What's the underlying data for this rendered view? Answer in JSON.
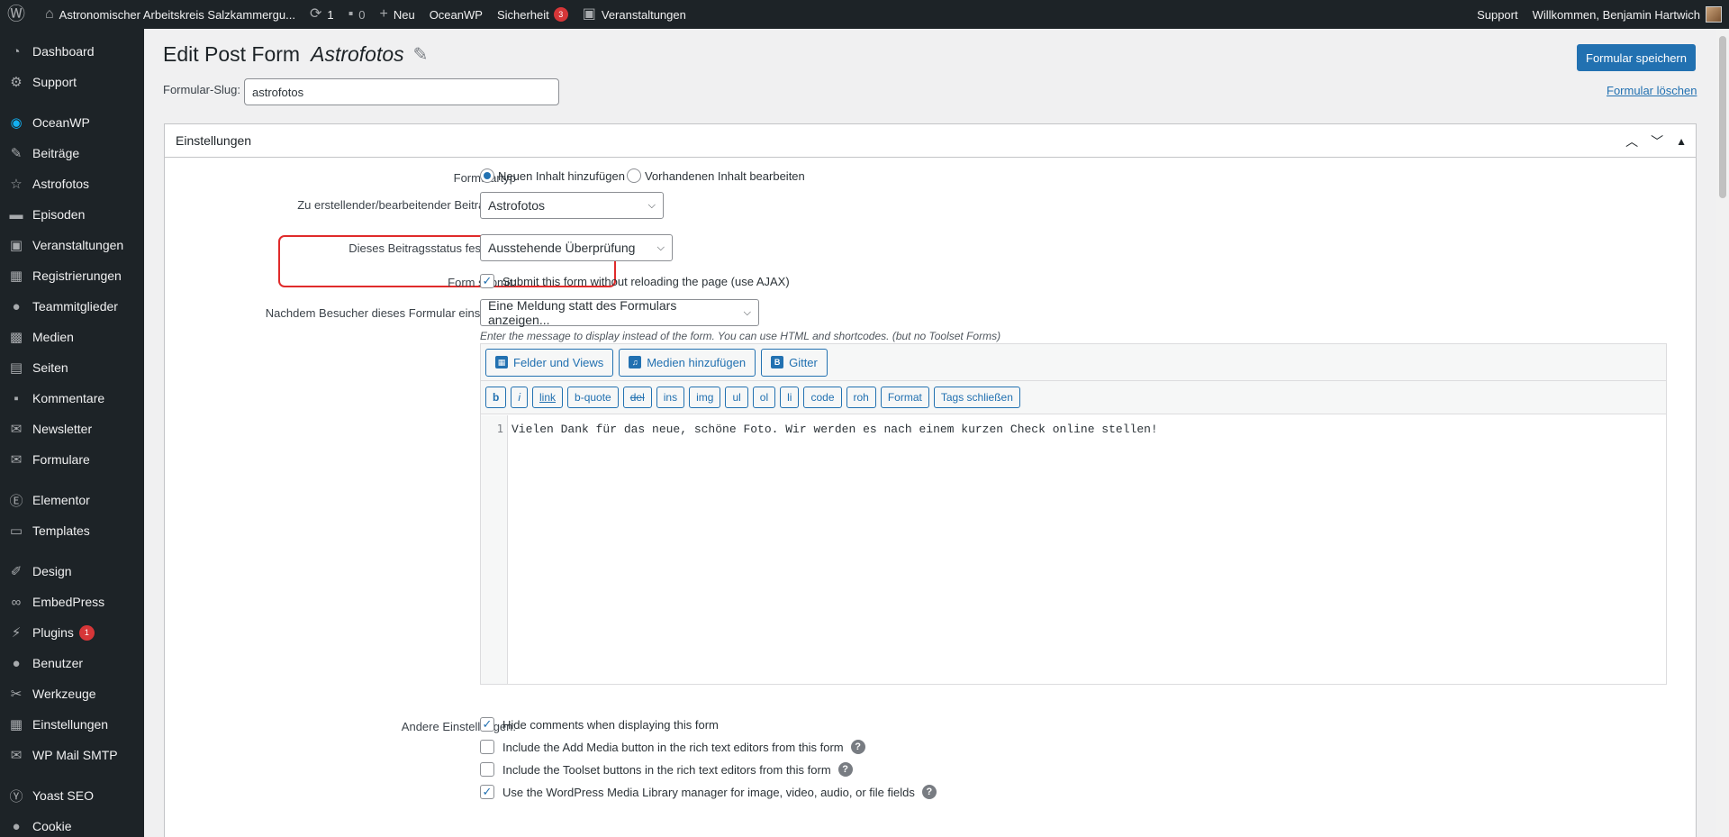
{
  "adminbar": {
    "site_name": "Astronomischer Arbeitskreis Salzkammergu...",
    "updates_count": "1",
    "comments_count": "0",
    "new_label": "Neu",
    "oceanwp_label": "OceanWP",
    "security_label": "Sicherheit",
    "security_count": "3",
    "events_label": "Veranstaltungen",
    "support_label": "Support",
    "welcome_label": "Willkommen, Benjamin Hartwich"
  },
  "sidebar": {
    "items": [
      {
        "label": "Dashboard",
        "icon": "dashboard-icon"
      },
      {
        "label": "Support",
        "icon": "gear-icon"
      },
      {
        "label": "OceanWP",
        "icon": "oceanwp-icon"
      },
      {
        "label": "Beiträge",
        "icon": "pin-icon"
      },
      {
        "label": "Astrofotos",
        "icon": "star-icon"
      },
      {
        "label": "Episoden",
        "icon": "podcast-icon"
      },
      {
        "label": "Veranstaltungen",
        "icon": "calendar-clapper-icon"
      },
      {
        "label": "Registrierungen",
        "icon": "calendar-icon"
      },
      {
        "label": "Teammitglieder",
        "icon": "users-icon"
      },
      {
        "label": "Medien",
        "icon": "media-icon"
      },
      {
        "label": "Seiten",
        "icon": "pages-icon"
      },
      {
        "label": "Kommentare",
        "icon": "comment-icon"
      },
      {
        "label": "Newsletter",
        "icon": "mail-icon"
      },
      {
        "label": "Formulare",
        "icon": "mail-form-icon"
      },
      {
        "label": "Elementor",
        "icon": "elementor-icon"
      },
      {
        "label": "Templates",
        "icon": "folder-icon"
      },
      {
        "label": "Design",
        "icon": "brush-icon"
      },
      {
        "label": "EmbedPress",
        "icon": "link-icon"
      },
      {
        "label": "Plugins",
        "icon": "plugin-icon",
        "count": "1"
      },
      {
        "label": "Benutzer",
        "icon": "user-icon"
      },
      {
        "label": "Werkzeuge",
        "icon": "wrench-icon"
      },
      {
        "label": "Einstellungen",
        "icon": "settings-icon"
      },
      {
        "label": "WP Mail SMTP",
        "icon": "mail-smtp-icon"
      },
      {
        "label": "Yoast SEO",
        "icon": "yoast-icon"
      },
      {
        "label": "Cookie",
        "icon": "cookie-icon"
      }
    ]
  },
  "header": {
    "title": "Edit Post Form",
    "post_name": "Astrofotos",
    "save_button": "Formular speichern",
    "slug_label": "Formular-Slug:",
    "slug_value": "astrofotos",
    "delete_link": "Formular löschen"
  },
  "settings": {
    "box_title": "Einstellungen",
    "form_type_label": "Formulartyp",
    "form_type_option_new": "Neuen Inhalt hinzufügen",
    "form_type_option_edit": "Vorhandenen Inhalt bearbeiten",
    "post_type_label": "Zu erstellender/bearbeitender Beitragstyp:",
    "post_type_value": "Astrofotos",
    "post_status_label": "Dieses Beitragsstatus festlegen:",
    "post_status_value": "Ausstehende Überprüfung",
    "form_submit_label": "Form submit:",
    "form_submit_text": "Submit this form without reloading the page (use AJAX)",
    "after_submit_label": "Nachdem Besucher dieses Formular einsenden:",
    "after_submit_value": "Eine Meldung statt des Formulars anzeigen...",
    "message_hint": "Enter the message to display instead of the form. You can use HTML and shortcodes. (but no Toolset Forms)",
    "other_label": "Andere Einstellungen:",
    "other_options": [
      {
        "text": "Hide comments when displaying this form",
        "checked": true,
        "help": false
      },
      {
        "text": "Include the Add Media button in the rich text editors from this form",
        "checked": false,
        "help": true
      },
      {
        "text": "Include the Toolset buttons in the rich text editors from this form",
        "checked": false,
        "help": true
      },
      {
        "text": "Use the WordPress Media Library manager for image, video, audio, or file fields",
        "checked": true,
        "help": true
      }
    ]
  },
  "editor": {
    "toolbar_buttons": [
      "Felder und Views",
      "Medien hinzufügen",
      "Gitter"
    ],
    "quicktags": [
      "b",
      "i",
      "link",
      "b-quote",
      "del",
      "ins",
      "img",
      "ul",
      "ol",
      "li",
      "code",
      "roh",
      "Format",
      "Tags schließen"
    ],
    "line_number": "1",
    "content": "Vielen Dank für das neue, schöne Foto. Wir werden es nach einem kurzen Check online stellen!"
  },
  "colors": {
    "accent": "#2271b1",
    "admin_dark": "#1d2327",
    "highlight": "#e02b2b",
    "badge": "#d63638"
  }
}
